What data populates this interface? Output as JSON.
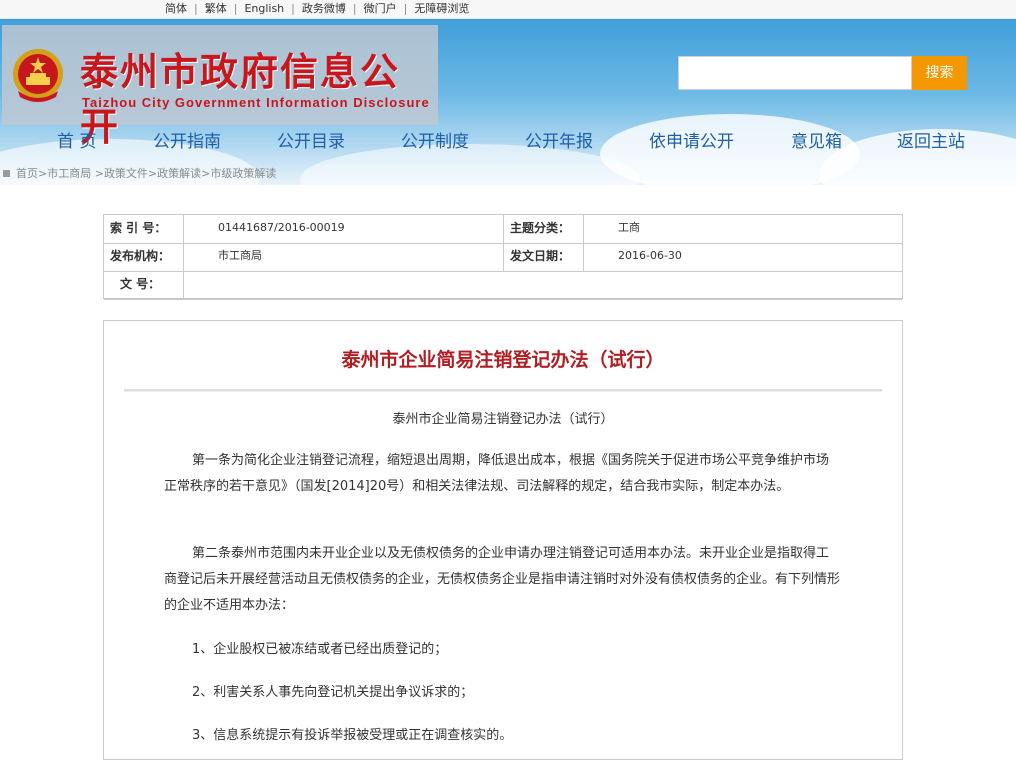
{
  "topbar": {
    "links": [
      "简体",
      "繁体",
      "English",
      "政务微博",
      "微门户",
      "无障碍浏览"
    ]
  },
  "header": {
    "title": "泰州市政府信息公开",
    "subtitle": "Taizhou City Government Information Disclosure",
    "search": {
      "placeholder": "",
      "button": "搜索"
    },
    "emblem_icon": "national-emblem-icon"
  },
  "nav": {
    "items": [
      "首 页",
      "公开指南",
      "公开目录",
      "公开制度",
      "公开年报",
      "依申请公开",
      "意见箱",
      "返回主站"
    ]
  },
  "breadcrumb": {
    "items": [
      "首页>",
      "市工商局 >",
      "政策文件>",
      "政策解读>",
      "市级政策解读"
    ]
  },
  "meta": {
    "index_label": "索 引 号：",
    "index_value": "01441687/2016-00019",
    "category_label": "主题分类：",
    "category_value": "工商",
    "org_label": "发布机构：",
    "org_value": "市工商局",
    "date_label": "发文日期：",
    "date_value": "2016-06-30",
    "docno_label": "文 号：",
    "docno_value": ""
  },
  "article": {
    "title": "泰州市企业简易注销登记办法（试行）",
    "subtitle": "泰州市企业简易注销登记办法（试行）",
    "p1": "第一条为简化企业注销登记流程，缩短退出周期，降低退出成本，根据《国务院关于促进市场公平竞争维护市场正常秩序的若干意见》（国发[2014]20号）和相关法律法规、司法解释的规定，结合我市实际，制定本办法。",
    "p2": "第二条泰州市范围内未开业企业以及无债权债务的企业申请办理注销登记可适用本办法。未开业企业是指取得工商登记后未开展经营活动且无债权债务的企业，无债权债务企业是指申请注销时对外没有债权债务的企业。有下列情形的企业不适用本办法：",
    "i1": "1、企业股权已被冻结或者已经出质登记的；",
    "i2": "2、利害关系人事先向登记机关提出争议诉求的；",
    "i3": "3、信息系统提示有投诉举报被受理或正在调查核实的。"
  },
  "colors": {
    "title_red": "#c8161d",
    "nav_blue": "#1e5fa8",
    "search_orange": "#f39800",
    "article_title_red": "#b01e23"
  }
}
